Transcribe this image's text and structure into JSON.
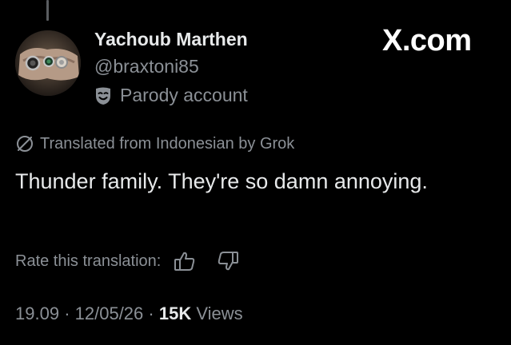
{
  "author": {
    "name": "Yachoub Marthen",
    "handle": "@braxtoni85",
    "parody_label": "Parody account",
    "avatar_icon": "avatar-photo-hand-with-rings"
  },
  "brand": "X.com",
  "translation": {
    "label": "Translated from Indonesian by Grok",
    "icon": "grok-icon",
    "rate_label": "Rate this translation:",
    "thumbs_up_icon": "thumbs-up-icon",
    "thumbs_down_icon": "thumbs-down-icon"
  },
  "tweet": {
    "text": "Thunder family. They're so damn annoying."
  },
  "meta": {
    "time": "19.09",
    "separator": "·",
    "date": "12/05/26",
    "views_count": "15K",
    "views_label": "Views"
  },
  "colors": {
    "background": "#000000",
    "primary_text": "#e7e9ea",
    "secondary_text": "#8b9096"
  }
}
